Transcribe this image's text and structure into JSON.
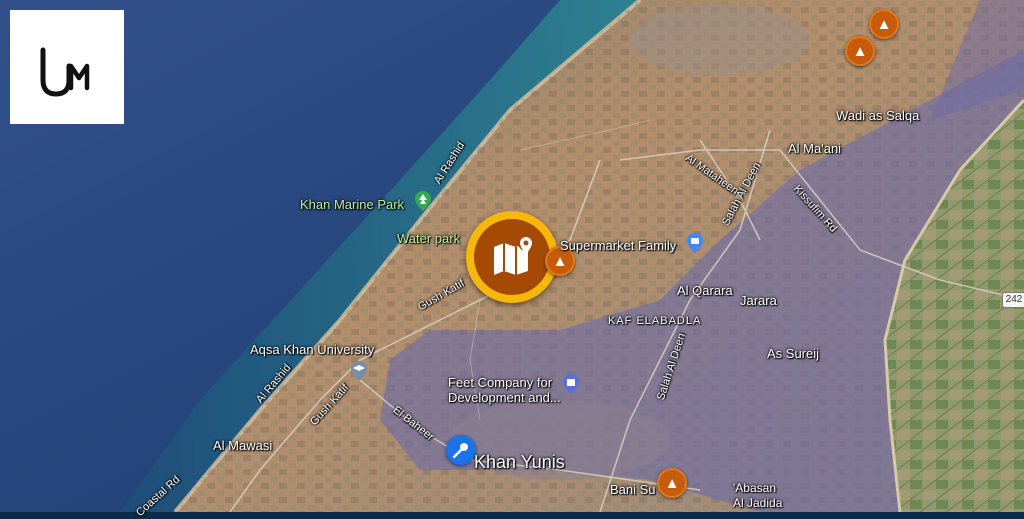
{
  "brand": {
    "logo_text": "UM"
  },
  "map": {
    "basemap": "satellite",
    "colors": {
      "sea": "#1c3f73",
      "shore": "#2d8a93",
      "land": "#b38d69",
      "overlay": "#6b6aa8",
      "marker_orange": "#c55b0b",
      "marker_gold": "#f6b70b",
      "marker_blue": "#1b73e8"
    },
    "places": {
      "khan_yunis": "Khan Yunis",
      "wadi_as_salqa": "Wadi as Salqa",
      "al_maani": "Al Ma'ani",
      "al_qarara": "Al Qarara",
      "jarara": "Jarara",
      "kaf_elabadla": "KAF ELABADLA",
      "as_sureij": "As Sureij",
      "al_mawasi": "Al Mawasi",
      "bani_suhaila": "Bani Su",
      "abasan_al_jadida": "'Abasan\nAl Jadida"
    },
    "pois": {
      "khan_marine_park": "Khan Marine Park",
      "water_park": "Water park",
      "supermarket_family": "Supermarket Family",
      "aqsa_khan_university": "Aqsa Khan University",
      "feet_company": "Feet Company for\nDevelopment and..."
    },
    "roads": {
      "al_rashid_north": "Al Rashid",
      "al_rashid_south": "Al Rashid",
      "gush_katif_north": "Gush Katif",
      "gush_katif_south": "Gush Katif",
      "al_mataheen": "Al Mataheen",
      "salah_al_deen_north": "Salah Al Deen",
      "salah_al_deen_south": "Salah Al Deen",
      "kissufim_rd": "Kissufim Rd",
      "el_baheer": "El Baheer",
      "coastal_rd": "Coastal Rd",
      "route_242": "242"
    },
    "markers": {
      "main": "map-marker",
      "events": [
        "bomb-marker",
        "bomb-marker",
        "bomb-marker",
        "bomb-marker"
      ],
      "speaker": "microphone-marker"
    }
  }
}
